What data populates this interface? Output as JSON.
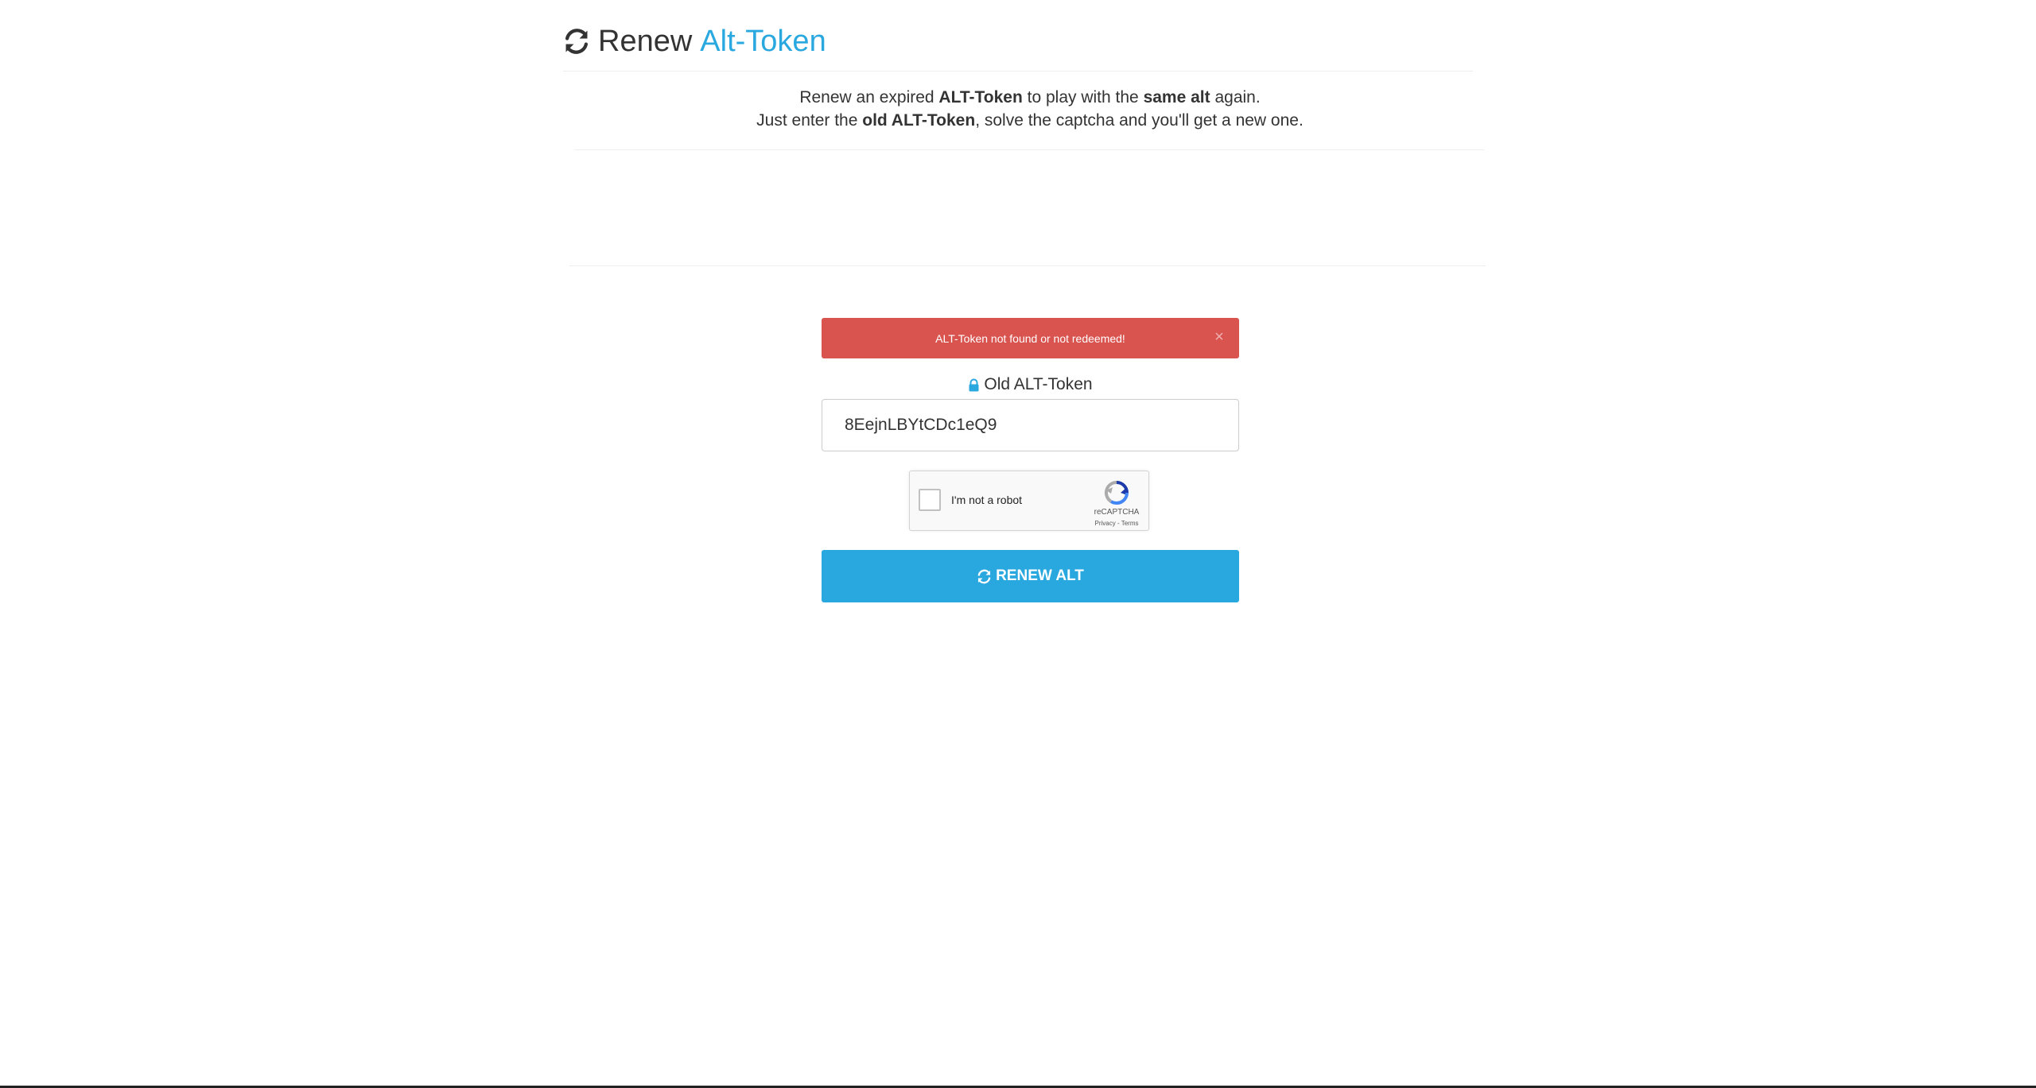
{
  "colors": {
    "accent": "#29a8e0",
    "danger": "#d9534f",
    "text": "#333333"
  },
  "header": {
    "icon": "refresh-icon",
    "title_prefix": "Renew",
    "title_accent": "Alt-Token"
  },
  "intro": {
    "line1": {
      "t1": "Renew an expired ",
      "b1": "ALT-Token",
      "t2": " to play with the ",
      "b2": "same alt",
      "t3": " again."
    },
    "line2": {
      "t1": "Just enter the ",
      "b1": "old ALT-Token",
      "t2": ", solve the captcha and you'll get a new one."
    }
  },
  "alert": {
    "message": "ALT-Token not found or not redeemed!",
    "close_label": "×"
  },
  "form": {
    "label_icon": "lock-icon",
    "label": "Old ALT-Token",
    "token_value": "8EejnLBYtCDc1eQ9"
  },
  "captcha": {
    "label": "I'm not a robot",
    "brand": "reCAPTCHA",
    "terms": "Privacy - Terms"
  },
  "submit": {
    "icon": "refresh-icon",
    "label": "RENEW ALT"
  }
}
